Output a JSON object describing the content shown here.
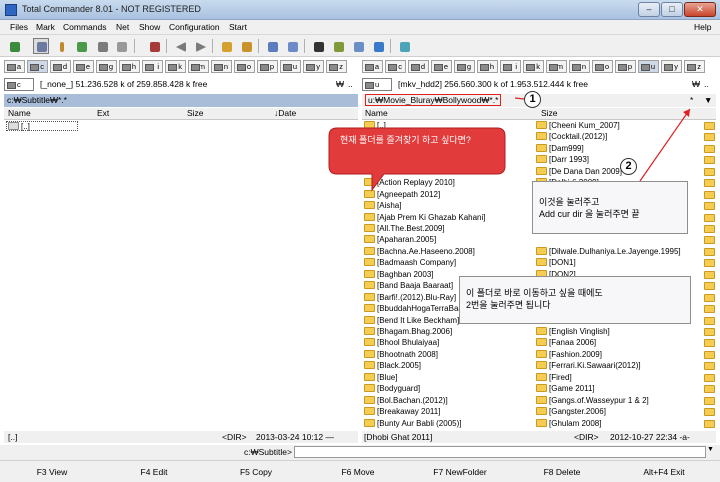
{
  "window": {
    "title": "Total Commander 8.01 - NOT REGISTERED",
    "min": "–",
    "max": "□",
    "close": "✕"
  },
  "menu": {
    "left": [
      "Files",
      "Mark",
      "Commands",
      "Net",
      "Show",
      "Configuration",
      "Start"
    ],
    "help": "Help"
  },
  "left": {
    "drives": [
      "a",
      "c",
      "d",
      "e",
      "g",
      "h",
      "i",
      "k",
      "m",
      "n",
      "o",
      "p",
      "u",
      "y",
      "z"
    ],
    "drive_sel": "c",
    "drive_info": "[_none_]  51.236.528 k of 259.858.428 k free",
    "backslash": "₩",
    "dotdot": "..",
    "path": "c:₩Subtitle₩*.*",
    "cols": {
      "name": "Name",
      "ext": "Ext",
      "size": "Size",
      "date": "↓Date"
    },
    "rows": [
      "[..]"
    ],
    "status_name": "[..]",
    "status_size": "<DIR>",
    "status_date": "2013-03-24 10:12 —"
  },
  "right": {
    "drives": [
      "a",
      "c",
      "d",
      "e",
      "g",
      "h",
      "i",
      "k",
      "m",
      "n",
      "o",
      "p",
      "u",
      "y",
      "z"
    ],
    "drive_sel": "u",
    "drive_info": "[mkv_hdd2]  256.560.300 k of 1.953.512.444 k free",
    "backslash": "₩",
    "dotdot": "..",
    "path": "u:₩Movie_Bluray₩Bollywood₩*.*",
    "star": "*",
    "arrow": "▼",
    "cols": {
      "name": "Name",
      "size": "Size"
    },
    "col1": [
      "[..]",
      "",
      "",
      "",
      "",
      "[Action Replayy 2010]",
      "[Agneepath 2012]",
      "[Aisha]",
      "[Ajab Prem Ki Ghazab Kahani]",
      "[All.The.Best.2009]",
      "[Apaharan.2005]",
      "[Bachna.Ae.Haseeno.2008]",
      "[Badmaash Company]",
      "[Baghban 2003]",
      "[Band Baaja Baaraat]",
      "[Barfi!.(2012).Blu-Ray]",
      "[BbuddahHogaTerraBaap]",
      "[Bend It Like Beckham]",
      "[Bhagam.Bhag.2006]",
      "[Bhool Bhulaiyaa]",
      "[Bhootnath 2008]",
      "[Black.2005]",
      "[Blue]",
      "[Bodyguard]",
      "[Bol.Bachan.(2012)]",
      "[Breakaway 2011]",
      "[Bunty Aur Babli (2005)]"
    ],
    "col2": [
      "[Cheeni Kum_2007]",
      "[Cocktail.(2012)]",
      "[Dam999]",
      "[Darr 1993]",
      "[De Dana Dan 2009]",
      "[Delhi-6.2009]",
      "",
      "",
      "",
      "",
      "",
      "[Dilwale.Dulhaniya.Le.Jayenge.1995]",
      "[DON1]",
      "[DON2]",
      "",
      "",
      "",
      "",
      "[English Vinglish]",
      "[Fanaa 2006]",
      "[Fashion.2009]",
      "[Ferrari.Ki.Sawaari(2012)]",
      "[Fired]",
      "[Game 2011]",
      "[Gangs.of.Wasseypur 1 & 2]",
      "[Gangster.2006]",
      "[Ghulam 2008]"
    ],
    "status_name": "[Dhobi Ghat 2011]",
    "status_size": "<DIR>",
    "status_date": "2012-10-27 22:34 -a-"
  },
  "cmdline": {
    "prompt": "c:₩Subtitle>"
  },
  "fkeys": [
    "F3 View",
    "F4 Edit",
    "F5 Copy",
    "F6 Move",
    "F7 NewFolder",
    "F8 Delete",
    "Alt+F4 Exit"
  ],
  "annotations": {
    "bubble": "현재 폴더를 즐겨찾기 하고 싶다면?",
    "note1": [
      "이것을 눌러주고",
      "Add cur dir 을 눌러주면 끝"
    ],
    "note2": [
      "이 폴더로 바로 이동하고 싶을 때에도",
      "2번을 눌러주면 됩니다"
    ],
    "marker1": "1",
    "marker2": "2"
  },
  "colors": {
    "path_active": "#a9bcd8",
    "selection": "#0a246a",
    "annotation_red": "#e02020",
    "bubble_fill": "#e23b3b",
    "folder": "#f4cd52"
  }
}
